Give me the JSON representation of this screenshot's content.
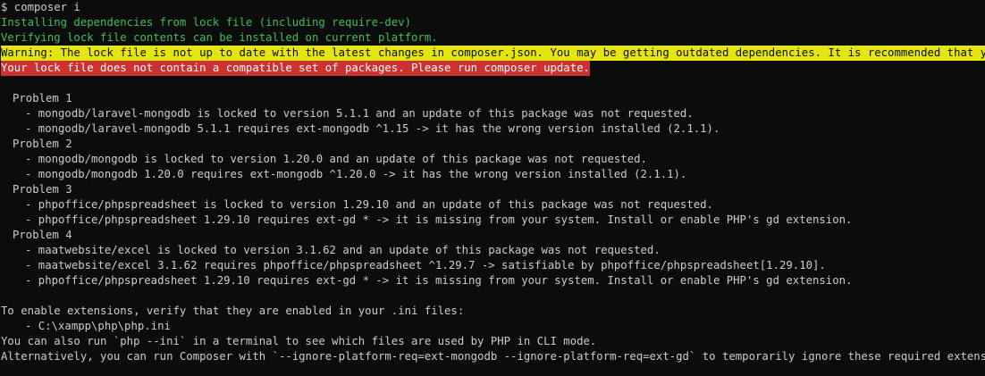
{
  "terminal": {
    "prompt": "$ composer i",
    "installing": "Installing dependencies from lock file (including require-dev)",
    "verifying": "Verifying lock file contents can be installed on current platform.",
    "warning": "Warning: The lock file is not up to date with the latest changes in composer.json. You may be getting outdated dependencies. It is recommended that you run `c",
    "error": "Your lock file does not contain a compatible set of packages. Please run composer update.",
    "problems": [
      {
        "title": "Problem 1",
        "items": [
          "- mongodb/laravel-mongodb is locked to version 5.1.1 and an update of this package was not requested.",
          "- mongodb/laravel-mongodb 5.1.1 requires ext-mongodb ^1.15 -> it has the wrong version installed (2.1.1)."
        ]
      },
      {
        "title": "Problem 2",
        "items": [
          "- mongodb/mongodb is locked to version 1.20.0 and an update of this package was not requested.",
          "- mongodb/mongodb 1.20.0 requires ext-mongodb ^1.20.0 -> it has the wrong version installed (2.1.1)."
        ]
      },
      {
        "title": "Problem 3",
        "items": [
          "- phpoffice/phpspreadsheet is locked to version 1.29.10 and an update of this package was not requested.",
          "- phpoffice/phpspreadsheet 1.29.10 requires ext-gd * -> it is missing from your system. Install or enable PHP's gd extension."
        ]
      },
      {
        "title": "Problem 4",
        "items": [
          "- maatwebsite/excel is locked to version 3.1.62 and an update of this package was not requested.",
          "- maatwebsite/excel 3.1.62 requires phpoffice/phpspreadsheet ^1.29.7 -> satisfiable by phpoffice/phpspreadsheet[1.29.10].",
          "- phpoffice/phpspreadsheet 1.29.10 requires ext-gd * -> it is missing from your system. Install or enable PHP's gd extension."
        ]
      }
    ],
    "enable_extensions": "To enable extensions, verify that they are enabled in your .ini files:",
    "ini_path": "- C:\\xampp\\php\\php.ini",
    "also_run": "You can also run `php --ini` in a terminal to see which files are used by PHP in CLI mode.",
    "alternatively": "Alternatively, you can run Composer with `--ignore-platform-req=ext-mongodb --ignore-platform-req=ext-gd` to temporarily ignore these required extensions."
  },
  "colors": {
    "background": "#0c0c0c",
    "text": "#cccccc",
    "green": "#3fbf5a",
    "warning_bg": "#e5e510",
    "error_bg": "#cd3131"
  }
}
